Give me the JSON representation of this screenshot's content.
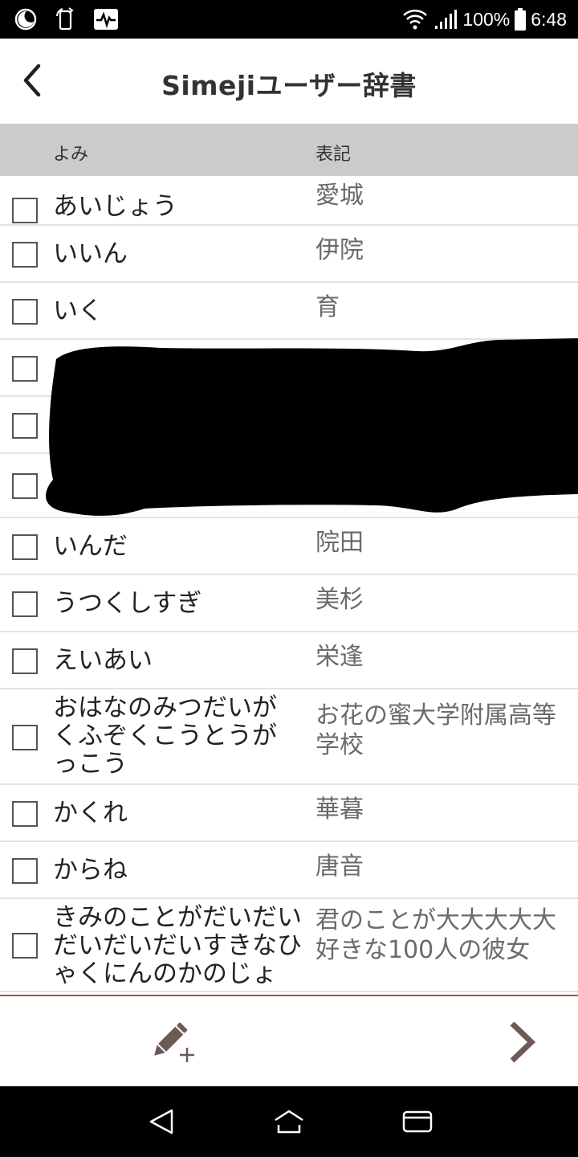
{
  "status_bar": {
    "battery": "100%",
    "time": "6:48",
    "icons": [
      "moon-icon",
      "rotate-phone-icon",
      "activity-monitor-icon",
      "wifi-icon",
      "signal-icon",
      "battery-icon"
    ]
  },
  "header": {
    "title": "Simejiユーザー辞書",
    "back_icon": "chevron-left-icon"
  },
  "columns": {
    "yomi": "よみ",
    "hyoki": "表記"
  },
  "entries": [
    {
      "yomi": "あいじょう",
      "hyoki": "愛城"
    },
    {
      "yomi": "いいん",
      "hyoki": "伊院"
    },
    {
      "yomi": "いく",
      "hyoki": "育"
    },
    {
      "yomi": "",
      "hyoki": "",
      "redacted": true
    },
    {
      "yomi": "",
      "hyoki": "",
      "redacted": true
    },
    {
      "yomi": "",
      "hyoki": "",
      "redacted": true
    },
    {
      "yomi": "いんだ",
      "hyoki": "院田"
    },
    {
      "yomi": "うつくしすぎ",
      "hyoki": "美杉"
    },
    {
      "yomi": "えいあい",
      "hyoki": "栄逢"
    },
    {
      "yomi": "おはなのみつだいが\nくふぞくこうとうが\nっこう",
      "hyoki": "お花の蜜大学附属高等\n学校"
    },
    {
      "yomi": "かくれ",
      "hyoki": "華暮"
    },
    {
      "yomi": "からね",
      "hyoki": "唐音"
    },
    {
      "yomi": "きみのことがだいだい\nだいだいだいすきなひ\nゃくにんのかのじょ",
      "hyoki": "君のことが大大大大大\n好きな100人の彼女"
    }
  ],
  "toolbar": {
    "add_icon": "pencil-add-icon",
    "next_icon": "chevron-right-icon"
  },
  "nav": {
    "icons": [
      "nav-back-icon",
      "nav-home-icon",
      "nav-recents-icon"
    ]
  },
  "colors": {
    "header_bg": "#c9cccb",
    "toolbar_border": "#a0523f",
    "icon_brown": "#6b5a55"
  }
}
